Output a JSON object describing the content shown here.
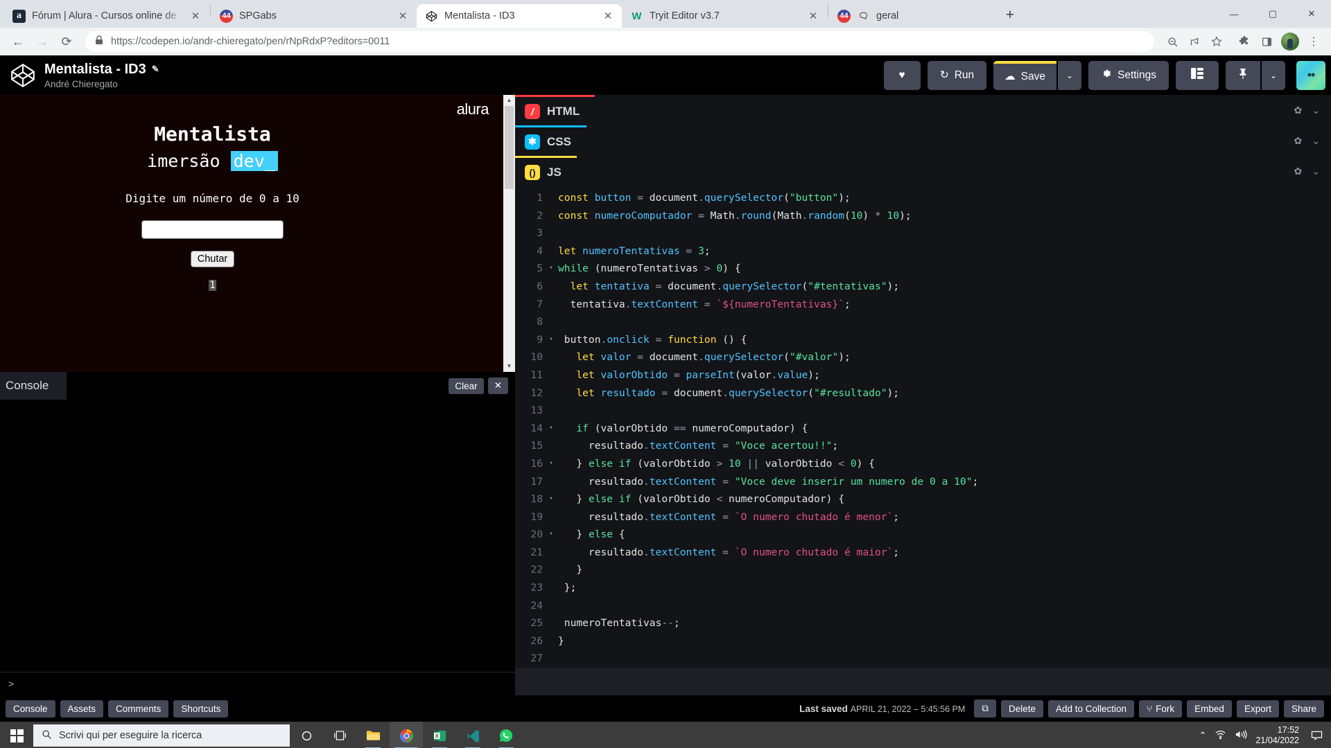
{
  "browser": {
    "tabs": [
      {
        "title": "Fórum | Alura - Cursos online de",
        "favicon": "alura-icon",
        "favicon_text": "a",
        "active": false
      },
      {
        "title": "SPGabs",
        "favicon": "spgabs-icon",
        "favicon_text": "44",
        "active": false
      },
      {
        "title": "Mentalista - ID3",
        "favicon": "codepen-icon",
        "favicon_text": "",
        "active": true
      },
      {
        "title": "Tryit Editor v3.7",
        "favicon": "w3schools-icon",
        "favicon_text": "W",
        "active": false
      },
      {
        "title": "geral",
        "favicon": "discord-icon",
        "favicon_text": "44",
        "active": false
      }
    ],
    "new_tab_label": "+",
    "close_label": "✕",
    "window_controls": {
      "minimize": "—",
      "maximize": "▢",
      "close": "✕"
    },
    "nav": {
      "back": "←",
      "forward": "→",
      "reload": "⟳"
    },
    "url": "https://codepen.io/andr-chieregato/pen/rNpRdxP?editors=0011",
    "url_bold_part": "codepen.io",
    "lock_icon": "🔒",
    "toolbar_icons": [
      "zoom-out-icon",
      "share-icon",
      "bookmark-star-icon",
      "extensions-icon",
      "sidepanel-icon",
      "profile-avatar",
      "chrome-menu-icon"
    ]
  },
  "codepen": {
    "pen_title": "Mentalista - ID3",
    "edit_icon": "✎",
    "author": "André Chieregato",
    "logo_name": "codepen-logo",
    "buttons": {
      "heart": "♥",
      "run": "Run",
      "run_icon": "↻",
      "save": "Save",
      "save_icon": "☁",
      "save_caret": "⌄",
      "settings": "Settings",
      "settings_icon": "✿",
      "layout_icon": "▤",
      "pin_icon": "📌",
      "pin_caret": "⌄"
    },
    "accent_yellow": "#ffdd40",
    "button_bg": "#444857"
  },
  "preview": {
    "brand": "alura",
    "title": "Mentalista",
    "subtitle_plain": "imersão ",
    "subtitle_highlight": "dev_",
    "highlight_color": "#44d0f8",
    "prompt": "Digite um número de 0 a 10",
    "input_value": "",
    "button_label": "Chutar",
    "result_value": "1",
    "scroll_up": "▲",
    "scroll_down": "▼"
  },
  "console": {
    "tab_label": "Console",
    "clear_label": "Clear",
    "close_label": "✕",
    "prompt": ">"
  },
  "editors": [
    {
      "lang": "HTML",
      "icon_glyph": "/",
      "icon_color": "#ff3c41",
      "gear": "✿",
      "caret": "⌄"
    },
    {
      "lang": "CSS",
      "icon_glyph": "✱",
      "icon_color": "#0ebeff",
      "gear": "✿",
      "caret": "⌄"
    },
    {
      "lang": "JS",
      "icon_glyph": "()",
      "icon_color": "#ffdd40",
      "gear": "✿",
      "caret": "⌄"
    }
  ],
  "code": {
    "language": "JS",
    "lines": [
      {
        "n": 1,
        "fold": "",
        "tokens": [
          [
            "t-kw",
            "const "
          ],
          [
            "t-var",
            "button"
          ],
          [
            "t-op",
            " = "
          ],
          [
            "t-plain",
            "document"
          ],
          [
            "t-op",
            "."
          ],
          [
            "t-fn",
            "querySelector"
          ],
          [
            "t-plain",
            "("
          ],
          [
            "t-str",
            "\"button\""
          ],
          [
            "t-plain",
            ");"
          ]
        ]
      },
      {
        "n": 2,
        "fold": "",
        "tokens": [
          [
            "t-kw",
            "const "
          ],
          [
            "t-var",
            "numeroComputador"
          ],
          [
            "t-op",
            " = "
          ],
          [
            "t-plain",
            "Math"
          ],
          [
            "t-op",
            "."
          ],
          [
            "t-fn",
            "round"
          ],
          [
            "t-plain",
            "(Math"
          ],
          [
            "t-op",
            "."
          ],
          [
            "t-fn",
            "random"
          ],
          [
            "t-plain",
            "("
          ],
          [
            "t-num",
            "10"
          ],
          [
            "t-plain",
            ") "
          ],
          [
            "t-op",
            "* "
          ],
          [
            "t-num",
            "10"
          ],
          [
            "t-plain",
            ");"
          ]
        ]
      },
      {
        "n": 3,
        "fold": "",
        "tokens": []
      },
      {
        "n": 4,
        "fold": "",
        "tokens": [
          [
            "t-kw",
            "let "
          ],
          [
            "t-var",
            "numeroTentativas"
          ],
          [
            "t-op",
            " = "
          ],
          [
            "t-num",
            "3"
          ],
          [
            "t-plain",
            ";"
          ]
        ]
      },
      {
        "n": 5,
        "fold": "▾",
        "tokens": [
          [
            "t-kw2",
            "while "
          ],
          [
            "t-plain",
            "(numeroTentativas "
          ],
          [
            "t-op",
            "> "
          ],
          [
            "t-num",
            "0"
          ],
          [
            "t-plain",
            ") {"
          ]
        ]
      },
      {
        "n": 6,
        "fold": "",
        "tokens": [
          [
            "t-plain",
            "  "
          ],
          [
            "t-kw",
            "let "
          ],
          [
            "t-var",
            "tentativa"
          ],
          [
            "t-op",
            " = "
          ],
          [
            "t-plain",
            "document"
          ],
          [
            "t-op",
            "."
          ],
          [
            "t-fn",
            "querySelector"
          ],
          [
            "t-plain",
            "("
          ],
          [
            "t-str",
            "\"#tentativas\""
          ],
          [
            "t-plain",
            ");"
          ]
        ]
      },
      {
        "n": 7,
        "fold": "",
        "tokens": [
          [
            "t-plain",
            "  tentativa"
          ],
          [
            "t-op",
            "."
          ],
          [
            "t-prop",
            "textContent"
          ],
          [
            "t-op",
            " = "
          ],
          [
            "t-tpl",
            "`${numeroTentativas}`"
          ],
          [
            "t-plain",
            ";"
          ]
        ]
      },
      {
        "n": 8,
        "fold": "",
        "tokens": []
      },
      {
        "n": 9,
        "fold": "▾",
        "tokens": [
          [
            "t-plain",
            " button"
          ],
          [
            "t-op",
            "."
          ],
          [
            "t-prop",
            "onclick"
          ],
          [
            "t-op",
            " = "
          ],
          [
            "t-kw",
            "function "
          ],
          [
            "t-plain",
            "() {"
          ]
        ]
      },
      {
        "n": 10,
        "fold": "",
        "tokens": [
          [
            "t-plain",
            "   "
          ],
          [
            "t-kw",
            "let "
          ],
          [
            "t-var",
            "valor"
          ],
          [
            "t-op",
            " = "
          ],
          [
            "t-plain",
            "document"
          ],
          [
            "t-op",
            "."
          ],
          [
            "t-fn",
            "querySelector"
          ],
          [
            "t-plain",
            "("
          ],
          [
            "t-str",
            "\"#valor\""
          ],
          [
            "t-plain",
            ");"
          ]
        ]
      },
      {
        "n": 11,
        "fold": "",
        "tokens": [
          [
            "t-plain",
            "   "
          ],
          [
            "t-kw",
            "let "
          ],
          [
            "t-var",
            "valorObtido"
          ],
          [
            "t-op",
            " = "
          ],
          [
            "t-fn",
            "parseInt"
          ],
          [
            "t-plain",
            "(valor"
          ],
          [
            "t-op",
            "."
          ],
          [
            "t-prop",
            "value"
          ],
          [
            "t-plain",
            ");"
          ]
        ]
      },
      {
        "n": 12,
        "fold": "",
        "tokens": [
          [
            "t-plain",
            "   "
          ],
          [
            "t-kw",
            "let "
          ],
          [
            "t-var",
            "resultado"
          ],
          [
            "t-op",
            " = "
          ],
          [
            "t-plain",
            "document"
          ],
          [
            "t-op",
            "."
          ],
          [
            "t-fn",
            "querySelector"
          ],
          [
            "t-plain",
            "("
          ],
          [
            "t-str",
            "\"#resultado\""
          ],
          [
            "t-plain",
            ");"
          ]
        ]
      },
      {
        "n": 13,
        "fold": "",
        "tokens": []
      },
      {
        "n": 14,
        "fold": "▾",
        "tokens": [
          [
            "t-plain",
            "   "
          ],
          [
            "t-kw2",
            "if "
          ],
          [
            "t-plain",
            "(valorObtido "
          ],
          [
            "t-op",
            "== "
          ],
          [
            "t-plain",
            "numeroComputador) {"
          ]
        ]
      },
      {
        "n": 15,
        "fold": "",
        "tokens": [
          [
            "t-plain",
            "     resultado"
          ],
          [
            "t-op",
            "."
          ],
          [
            "t-prop",
            "textContent"
          ],
          [
            "t-op",
            " = "
          ],
          [
            "t-str",
            "\"Voce acertou!!\""
          ],
          [
            "t-plain",
            ";"
          ]
        ]
      },
      {
        "n": 16,
        "fold": "▾",
        "tokens": [
          [
            "t-plain",
            "   } "
          ],
          [
            "t-kw2",
            "else if "
          ],
          [
            "t-plain",
            "(valorObtido "
          ],
          [
            "t-op",
            "> "
          ],
          [
            "t-num",
            "10 "
          ],
          [
            "t-op",
            "|| "
          ],
          [
            "t-plain",
            "valorObtido "
          ],
          [
            "t-op",
            "< "
          ],
          [
            "t-num",
            "0"
          ],
          [
            "t-plain",
            ") {"
          ]
        ]
      },
      {
        "n": 17,
        "fold": "",
        "tokens": [
          [
            "t-plain",
            "     resultado"
          ],
          [
            "t-op",
            "."
          ],
          [
            "t-prop",
            "textContent"
          ],
          [
            "t-op",
            " = "
          ],
          [
            "t-str",
            "\"Voce deve inserir um numero de 0 a 10\""
          ],
          [
            "t-plain",
            ";"
          ]
        ]
      },
      {
        "n": 18,
        "fold": "▾",
        "tokens": [
          [
            "t-plain",
            "   } "
          ],
          [
            "t-kw2",
            "else if "
          ],
          [
            "t-plain",
            "(valorObtido "
          ],
          [
            "t-op",
            "< "
          ],
          [
            "t-plain",
            "numeroComputador) {"
          ]
        ]
      },
      {
        "n": 19,
        "fold": "",
        "tokens": [
          [
            "t-plain",
            "     resultado"
          ],
          [
            "t-op",
            "."
          ],
          [
            "t-prop",
            "textContent"
          ],
          [
            "t-op",
            " = "
          ],
          [
            "t-tpl",
            "`O numero chutado é menor`"
          ],
          [
            "t-plain",
            ";"
          ]
        ]
      },
      {
        "n": 20,
        "fold": "▾",
        "tokens": [
          [
            "t-plain",
            "   } "
          ],
          [
            "t-kw2",
            "else "
          ],
          [
            "t-plain",
            "{"
          ]
        ]
      },
      {
        "n": 21,
        "fold": "",
        "tokens": [
          [
            "t-plain",
            "     resultado"
          ],
          [
            "t-op",
            "."
          ],
          [
            "t-prop",
            "textContent"
          ],
          [
            "t-op",
            " = "
          ],
          [
            "t-tpl",
            "`O numero chutado é maior`"
          ],
          [
            "t-plain",
            ";"
          ]
        ]
      },
      {
        "n": 22,
        "fold": "",
        "tokens": [
          [
            "t-plain",
            "   }"
          ]
        ]
      },
      {
        "n": 23,
        "fold": "",
        "tokens": [
          [
            "t-plain",
            " };"
          ]
        ]
      },
      {
        "n": 24,
        "fold": "",
        "tokens": []
      },
      {
        "n": 25,
        "fold": "",
        "tokens": [
          [
            "t-plain",
            " numeroTentativas"
          ],
          [
            "t-op",
            "--"
          ],
          [
            "t-plain",
            ";"
          ]
        ]
      },
      {
        "n": 26,
        "fold": "",
        "tokens": [
          [
            "t-plain",
            "}"
          ]
        ]
      },
      {
        "n": 27,
        "fold": "",
        "tokens": []
      }
    ]
  },
  "footer": {
    "left_buttons": [
      "Console",
      "Assets",
      "Comments",
      "Shortcuts"
    ],
    "last_saved_label": "Last saved",
    "last_saved_time": "APRIL 21, 2022 – 5:45:56 PM",
    "open_icon": "⧉",
    "right_buttons": [
      "Delete",
      "Add to Collection",
      "Fork",
      "Embed",
      "Export",
      "Share"
    ],
    "fork_icon": "⑂"
  },
  "taskbar": {
    "start_icon": "windows-logo",
    "search_placeholder": "Scrivi qui per eseguire la ricerca",
    "search_icon": "🔍",
    "apps": [
      {
        "name": "cortana-icon",
        "glyph": "◯"
      },
      {
        "name": "task-view-icon",
        "glyph": "❏"
      },
      {
        "name": "file-explorer-icon",
        "glyph": "📁"
      },
      {
        "name": "chrome-icon",
        "glyph": "◉"
      },
      {
        "name": "excel-icon",
        "glyph": "X"
      },
      {
        "name": "vscode-icon",
        "glyph": "✕"
      },
      {
        "name": "whatsapp-icon",
        "glyph": "✆"
      }
    ],
    "tray": {
      "chevron": "⌃",
      "wifi": "📶",
      "volume": "🔊"
    },
    "time": "17:52",
    "date": "21/04/2022",
    "notification_icon": "🗨"
  }
}
